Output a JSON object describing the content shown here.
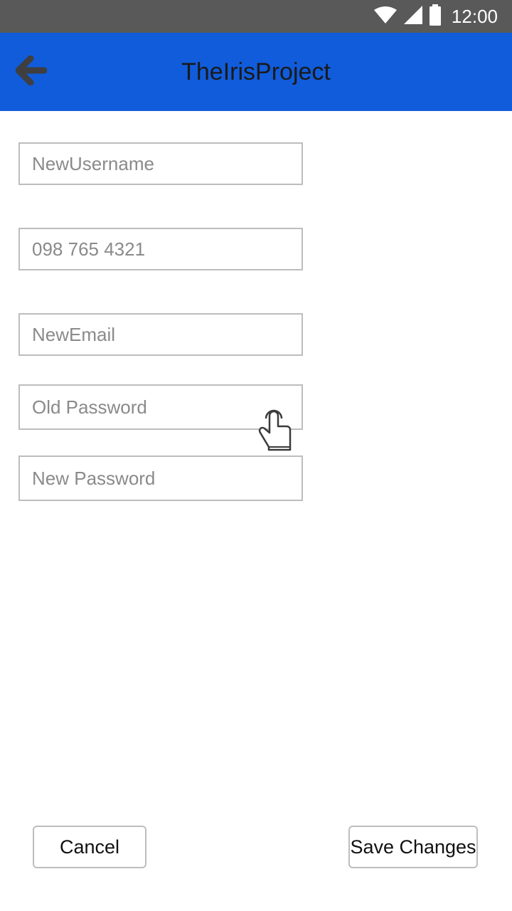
{
  "status_bar": {
    "time": "12:00",
    "icons": [
      "wifi-icon",
      "cellular-signal-icon",
      "battery-icon"
    ]
  },
  "app_bar": {
    "title": "TheIrisProject",
    "back_icon": "arrow-left-icon",
    "background_color": "#105cdb"
  },
  "form": {
    "username": {
      "value": "",
      "placeholder": "NewUsername"
    },
    "phone": {
      "value": "",
      "placeholder": "098 765 4321"
    },
    "email": {
      "value": "",
      "placeholder": "NewEmail"
    },
    "old_password": {
      "value": "",
      "placeholder": "Old Password"
    },
    "new_password": {
      "value": "",
      "placeholder": "New Password"
    }
  },
  "touch_hint_icon": "tap-gesture-icon",
  "buttons": {
    "cancel_label": "Cancel",
    "save_label": "Save Changes"
  }
}
